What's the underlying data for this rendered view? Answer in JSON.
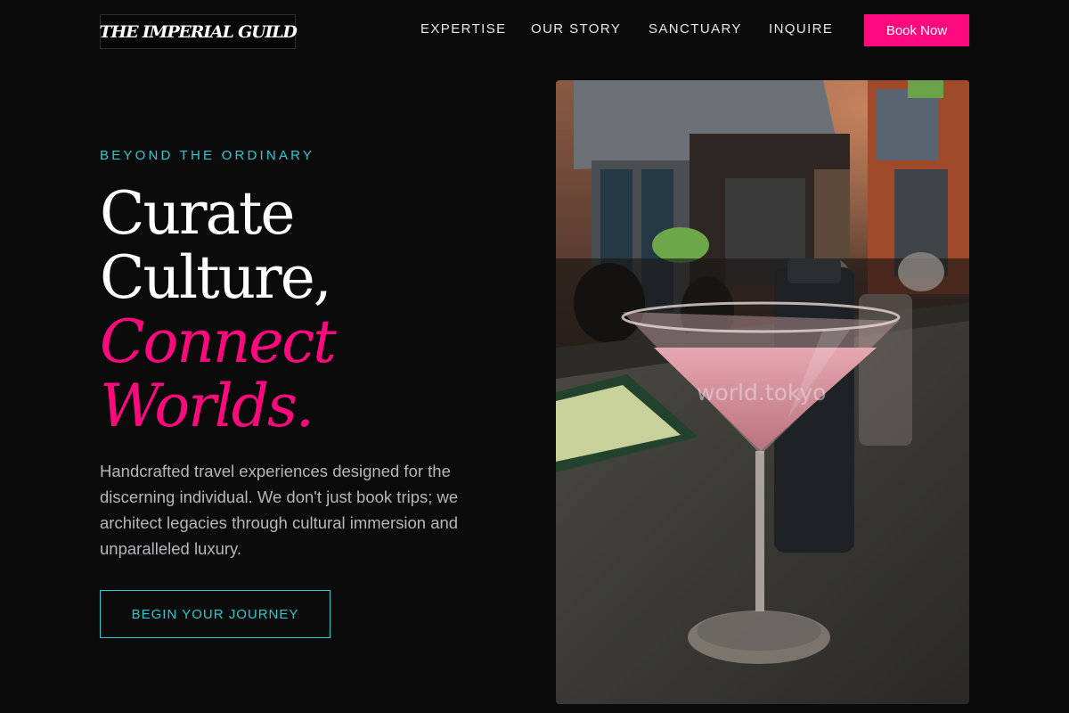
{
  "brand": {
    "logo_text": "THE IMPERIAL GUILD"
  },
  "nav": {
    "links": [
      "EXPERTISE",
      "OUR STORY",
      "SANCTUARY",
      "INQUIRE"
    ],
    "cta_label": "Book Now"
  },
  "hero": {
    "eyebrow": "BEYOND THE ORDINARY",
    "headline_line1": "Curate",
    "headline_line2": "Culture,",
    "headline_line3": "Connect",
    "headline_line4": "Worlds.",
    "body": "Handcrafted travel experiences designed for the discerning individual. We don't just book trips; we architect legacies through cultural immersion and unparalleled luxury.",
    "cta_label": "BEGIN YOUR JOURNEY",
    "image_watermark": "world.tokyo"
  },
  "colors": {
    "background": "#0b0b0c",
    "accent_pink": "#ff0a7e",
    "accent_teal": "#2ec9d0",
    "body_text": "#b7b7ba"
  }
}
